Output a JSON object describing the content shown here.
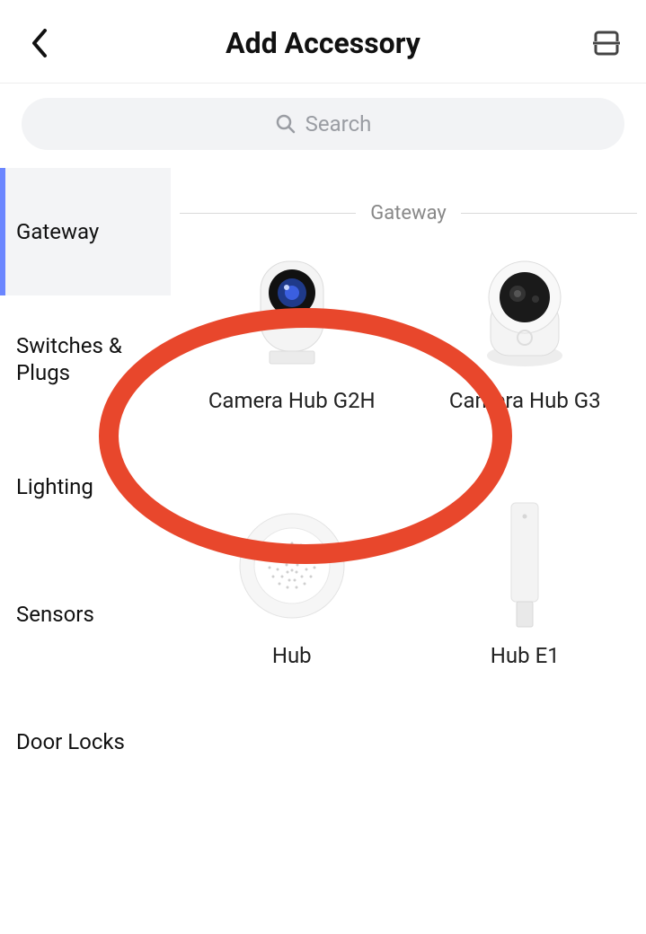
{
  "header": {
    "title": "Add Accessory"
  },
  "search": {
    "placeholder": "Search"
  },
  "sidebar": {
    "items": [
      {
        "label": "Gateway",
        "active": true
      },
      {
        "label": "Switches & Plugs",
        "active": false
      },
      {
        "label": "Lighting",
        "active": false
      },
      {
        "label": "Sensors",
        "active": false
      },
      {
        "label": "Door Locks",
        "active": false
      }
    ]
  },
  "section": {
    "title": "Gateway"
  },
  "products": [
    {
      "label": "Camera Hub G2H",
      "icon": "camera-g2h"
    },
    {
      "label": "Camera Hub G3",
      "icon": "camera-g3"
    },
    {
      "label": "Hub",
      "icon": "hub-round"
    },
    {
      "label": "Hub E1",
      "icon": "hub-stick"
    }
  ],
  "annotation": {
    "target": "Camera Hub G2H",
    "color": "#e8472c"
  }
}
